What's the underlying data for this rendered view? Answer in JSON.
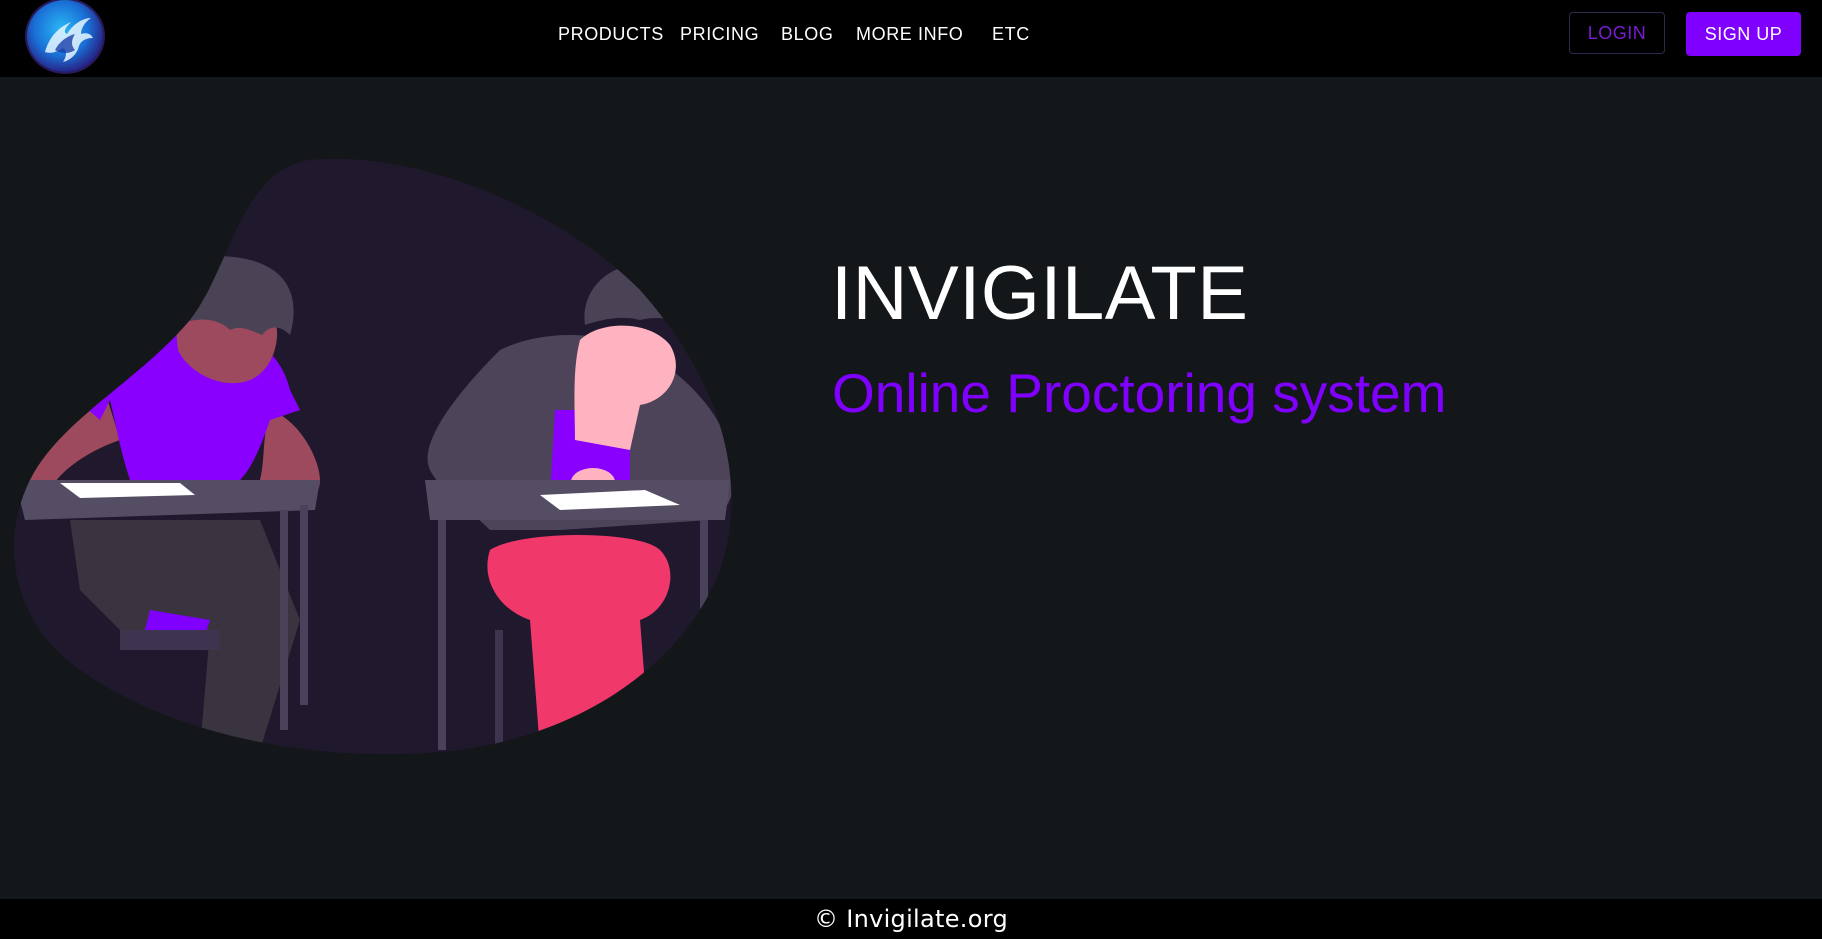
{
  "navbar": {
    "logo_icon": "phoenix-logo-icon",
    "links": [
      {
        "label": "PRODUCTS"
      },
      {
        "label": "PRICING"
      },
      {
        "label": "BLOG"
      },
      {
        "label": "MORE INFO"
      },
      {
        "label": "ETC"
      }
    ],
    "login_label": "LOGIN",
    "signup_label": "SIGN UP"
  },
  "hero": {
    "title": "INVIGILATE",
    "subtitle": "Online Proctoring system",
    "illustration_icon": "students-taking-exam-illustration"
  },
  "footer": {
    "text": "© Invigilate.org"
  },
  "colors": {
    "background": "#141719",
    "navbar": "#000000",
    "accent": "#8000ff",
    "text": "#ffffff"
  }
}
